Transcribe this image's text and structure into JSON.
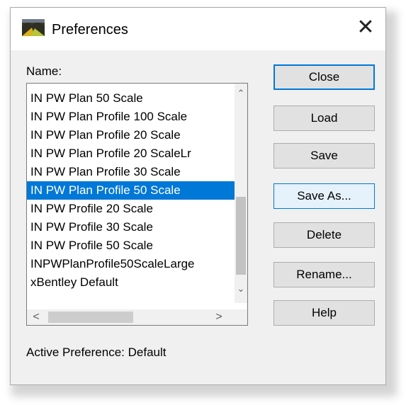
{
  "window": {
    "title": "Preferences",
    "close_glyph": "✕",
    "icon": "preferences-app-icon"
  },
  "name_label": "Name:",
  "list": {
    "items": [
      "IN PW Plan 50 Scale",
      "IN PW Plan Profile 100 Scale",
      "IN PW Plan Profile 20 Scale",
      "IN PW Plan Profile 20 ScaleLr",
      "IN PW Plan Profile 30 Scale",
      "IN PW Plan Profile 50 Scale",
      "IN PW Profile 20 Scale",
      "IN PW Profile 30 Scale",
      "IN PW Profile 50 Scale",
      "INPWPlanProfile50ScaleLarge",
      "xBentley Default"
    ],
    "selected_index": 5,
    "scroll_up": "⌃",
    "scroll_down": "⌄",
    "scroll_left": "<",
    "scroll_right": ">"
  },
  "buttons": {
    "close": "Close",
    "load": "Load",
    "save": "Save",
    "save_as": "Save As...",
    "delete": "Delete",
    "rename": "Rename...",
    "help": "Help"
  },
  "status": "Active Preference: Default",
  "colors": {
    "selection": "#0078d7",
    "dialog_bg": "#f0f0f0"
  }
}
